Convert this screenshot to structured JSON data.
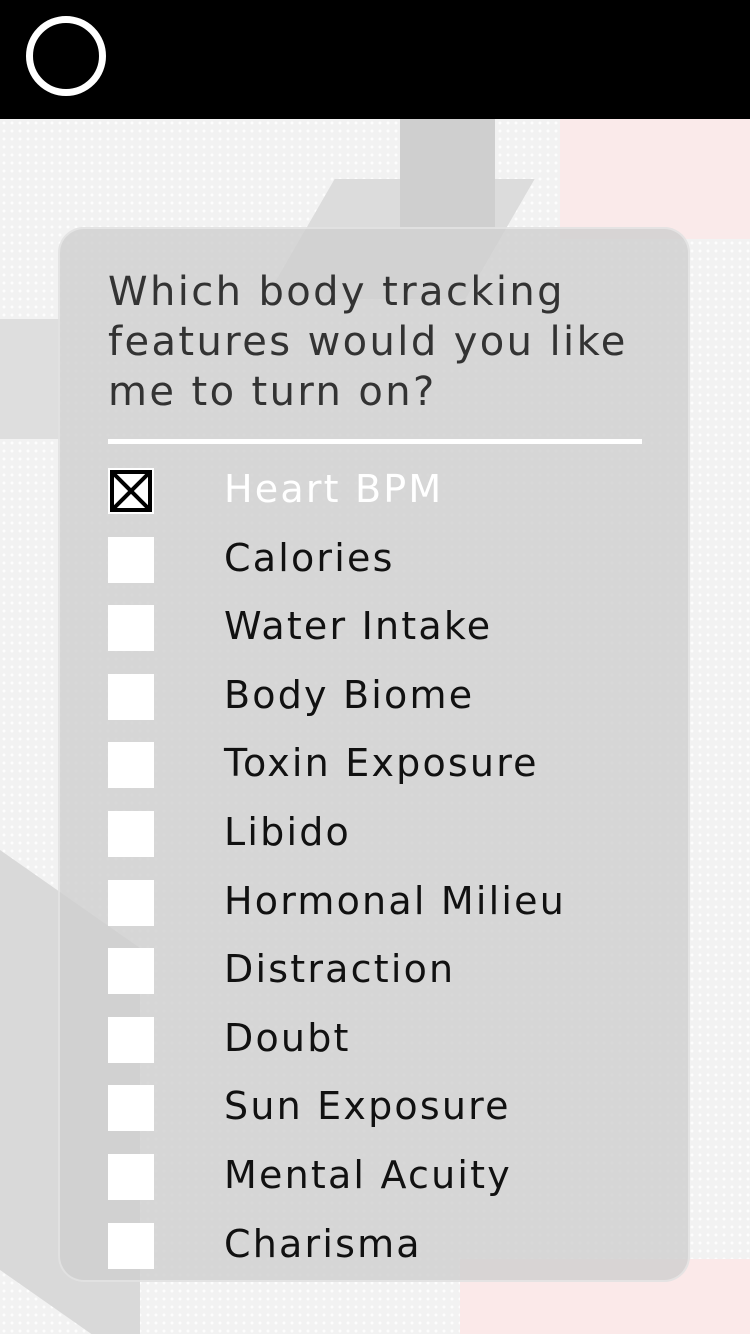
{
  "header": {
    "logo_icon": "ring-icon"
  },
  "card": {
    "question": "Which body tracking features would you like me to turn on?",
    "options": [
      {
        "label": "Heart BPM",
        "checked": true
      },
      {
        "label": "Calories",
        "checked": false
      },
      {
        "label": "Water Intake",
        "checked": false
      },
      {
        "label": "Body Biome",
        "checked": false
      },
      {
        "label": "Toxin Exposure",
        "checked": false
      },
      {
        "label": "Libido",
        "checked": false
      },
      {
        "label": "Hormonal Milieu",
        "checked": false
      },
      {
        "label": "Distraction",
        "checked": false
      },
      {
        "label": "Doubt",
        "checked": false
      },
      {
        "label": "Sun Exposure",
        "checked": false
      },
      {
        "label": "Mental Acuity",
        "checked": false
      },
      {
        "label": "Charisma",
        "checked": false
      }
    ]
  },
  "colors": {
    "header_bg": "#000000",
    "selected_label": "#ffffff",
    "label": "#111111"
  }
}
